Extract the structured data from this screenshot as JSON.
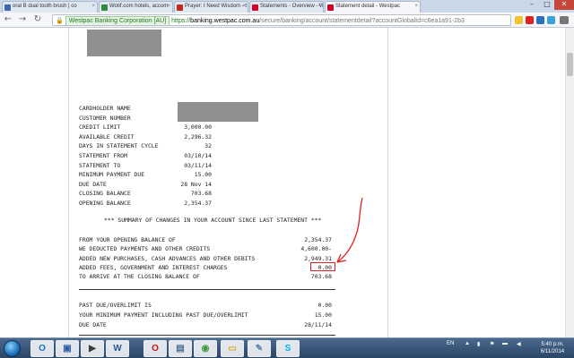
{
  "tabs": [
    {
      "label": "oral B dual tooth brush | co",
      "fav_color": "#3a67b0",
      "active": false
    },
    {
      "label": "Wotif.com hotels, accom",
      "fav_color": "#2e8b3d",
      "active": false
    },
    {
      "label": "Prayer: I Need Wisdom - t",
      "fav_color": "#c5281c",
      "active": false
    },
    {
      "label": "Statements - Overview - W",
      "fav_color": "#d4002a",
      "active": false
    },
    {
      "label": "Statement detail - Westpac",
      "fav_color": "#d4002a",
      "active": true
    }
  ],
  "window_controls": {
    "minimize": "–",
    "maximize": "□",
    "close": "✕"
  },
  "toolbar": {
    "back": "←",
    "forward": "→",
    "reload": "↻",
    "ev_label": "Westpac Banking Corporation [AU]",
    "url_scheme": "https://",
    "url_host": "banking.westpac.com.au",
    "url_path": "/secure/banking/account/statementdetail?accountGlobalId=c6ea1a91-2b3"
  },
  "statement": {
    "details": [
      {
        "label": "CARDHOLDER NAME",
        "value": ""
      },
      {
        "label": "CUSTOMER NUMBER",
        "value": ""
      },
      {
        "label": "CREDIT LIMIT",
        "value": "3,000.00"
      },
      {
        "label": "AVAILABLE CREDIT",
        "value": "2,296.32"
      },
      {
        "label": "DAYS IN STATEMENT CYCLE",
        "value": "32"
      },
      {
        "label": "STATEMENT FROM",
        "value": "03/10/14"
      },
      {
        "label": "STATEMENT TO",
        "value": "03/11/14"
      },
      {
        "label": "MINIMUM PAYMENT DUE",
        "value": "15.00"
      },
      {
        "label": "DUE DATE",
        "value": "28 Nov 14"
      },
      {
        "label": "CLOSING BALANCE",
        "value": "703.68"
      },
      {
        "label": "OPENING BALANCE",
        "value": "2,354.37"
      }
    ],
    "summary_title": "*** SUMMARY OF CHANGES IN YOUR ACCOUNT SINCE LAST STATEMENT ***",
    "summary": [
      {
        "label": "FROM YOUR OPENING BALANCE OF",
        "value": "2,354.37"
      },
      {
        "label": "WE DEDUCTED PAYMENTS AND OTHER CREDITS",
        "value": "4,600.00-"
      },
      {
        "label": "ADDED NEW PURCHASES, CASH ADVANCES AND OTHER DEBITS",
        "value": "2,949.31"
      },
      {
        "label": "ADDED FEES, GOVERNMENT AND INTEREST CHARGES",
        "value": "0.00"
      },
      {
        "label": "TO ARRIVE AT THE CLOSING BALANCE OF",
        "value": "703.68"
      }
    ],
    "due": [
      {
        "label": "PAST DUE/OVERLIMIT IS",
        "value": "0.00"
      },
      {
        "label": "YOUR MINIMUM PAYMENT INCLUDING PAST DUE/OVERLIMIT",
        "value": "15.00"
      },
      {
        "label": "DUE DATE",
        "value": "28/11/14"
      }
    ]
  },
  "annotation_color": "#e02020",
  "taskbar": {
    "apps": [
      {
        "name": "outlook",
        "glyph": "O",
        "color": "#1f6fc5"
      },
      {
        "name": "app-blue",
        "glyph": "▣",
        "color": "#2b5ea7"
      },
      {
        "name": "media",
        "glyph": "▶",
        "color": "#3a3a3a"
      },
      {
        "name": "word",
        "glyph": "W",
        "color": "#2b579a"
      },
      {
        "name": "opera",
        "glyph": "O",
        "color": "#cc0f16"
      },
      {
        "name": "computer",
        "glyph": "▤",
        "color": "#4a6d94"
      },
      {
        "name": "chrome",
        "glyph": "◉",
        "color": "#3f9b3f"
      },
      {
        "name": "explorer",
        "glyph": "▭",
        "color": "#d9a62e"
      },
      {
        "name": "paint",
        "glyph": "✎",
        "color": "#5a7fb0"
      },
      {
        "name": "skype",
        "glyph": "S",
        "color": "#00aff0"
      }
    ],
    "lang": "EN",
    "time": "5:40 p.m.",
    "date": "6/11/2014"
  }
}
